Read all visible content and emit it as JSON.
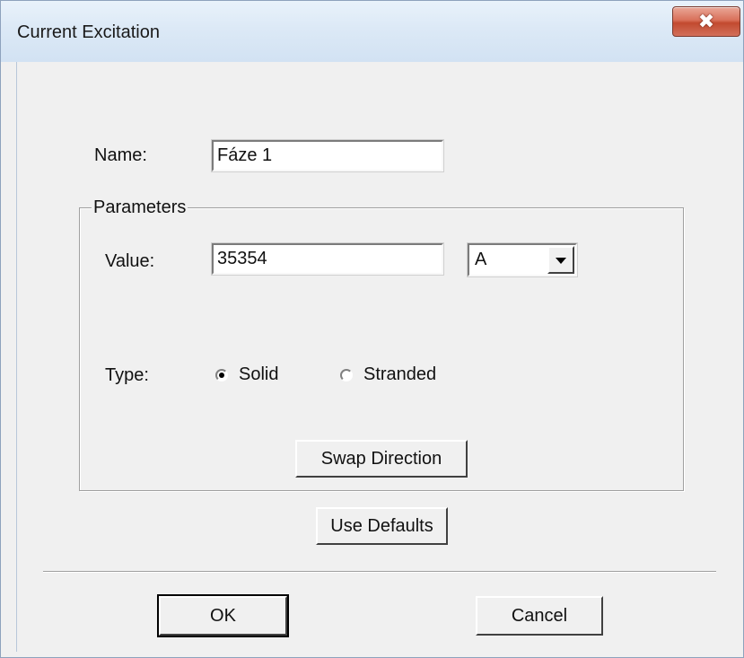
{
  "window": {
    "title": "Current Excitation",
    "close_glyph": "✖"
  },
  "form": {
    "name_label": "Name:",
    "name_value": "Fáze 1"
  },
  "parameters": {
    "group_title": "Parameters",
    "value_label": "Value:",
    "value": "35354",
    "unit_selected": "A",
    "type_label": "Type:",
    "type_options": [
      {
        "label": "Solid",
        "selected": true
      },
      {
        "label": "Stranded",
        "selected": false
      }
    ],
    "swap_button": "Swap Direction"
  },
  "buttons": {
    "use_defaults": "Use Defaults",
    "ok": "OK",
    "cancel": "Cancel"
  },
  "icons": {
    "close": "close-icon",
    "dropdown": "chevron-down-icon"
  }
}
